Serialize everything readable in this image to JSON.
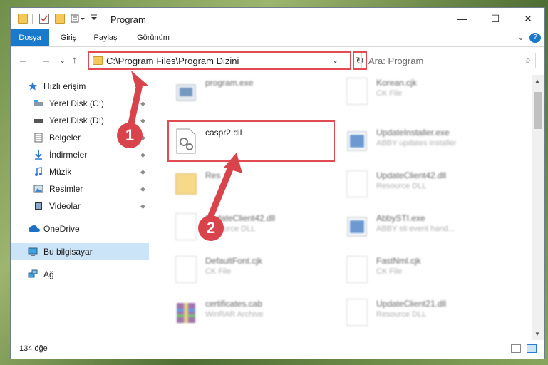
{
  "window": {
    "title": "Program",
    "minimize": "—",
    "maximize": "☐",
    "close": "✕"
  },
  "ribbon": {
    "tabs": [
      "Dosya",
      "Giriş",
      "Paylaş",
      "Görünüm"
    ],
    "expand": "⌄",
    "help": "?"
  },
  "nav": {
    "back": "←",
    "forward": "→",
    "recent": "⌄",
    "up": "↑",
    "address": "C:\\Program Files\\Program Dizini",
    "dropdown": "⌄",
    "refresh": "↻",
    "search_placeholder": "Ara: Program",
    "search_glyph": "⌕"
  },
  "sidebar": {
    "items": [
      {
        "label": "Hızlı erişim",
        "icon": "star-icon"
      },
      {
        "label": "Yerel Disk (C:)",
        "icon": "drive-icon",
        "pinned": true
      },
      {
        "label": "Yerel Disk (D:)",
        "icon": "drive-icon",
        "pinned": true
      },
      {
        "label": "Belgeler",
        "icon": "documents-icon",
        "pinned": true
      },
      {
        "label": "İndirmeler",
        "icon": "download-icon",
        "pinned": true
      },
      {
        "label": "Müzik",
        "icon": "music-icon",
        "pinned": true
      },
      {
        "label": "Resimler",
        "icon": "pictures-icon",
        "pinned": true
      },
      {
        "label": "Videolar",
        "icon": "video-icon",
        "pinned": true
      },
      {
        "label": "OneDrive",
        "icon": "cloud-icon"
      },
      {
        "label": "Bu bilgisayar",
        "icon": "computer-icon",
        "selected": true
      },
      {
        "label": "Ağ",
        "icon": "network-icon"
      }
    ],
    "pin_glyph": "📌"
  },
  "files": [
    {
      "name": "program.exe",
      "desc": "",
      "icon": "exe-icon"
    },
    {
      "name": "Korean.cjk",
      "desc": "CK File",
      "icon": "document-icon"
    },
    {
      "name": "caspr2.dll",
      "desc": "",
      "icon": "dll-icon"
    },
    {
      "name": "UpdateInstaller.exe",
      "desc": "ABBY updates installer",
      "icon": "exe-icon"
    },
    {
      "name": "Res",
      "desc": "",
      "icon": "folder-icon"
    },
    {
      "name": "UpdateClient42.dll",
      "desc": "Resource DLL",
      "icon": "dll-icon"
    },
    {
      "name": "UpdateClient42.dll",
      "desc": "Resource DLL",
      "icon": "dll-icon"
    },
    {
      "name": "AbbySTI.exe",
      "desc": "ABBY sti event hand...",
      "icon": "exe-icon"
    },
    {
      "name": "DefaultFont.cjk",
      "desc": "CK File",
      "icon": "document-icon"
    },
    {
      "name": "FastNml.cjk",
      "desc": "CK File",
      "icon": "document-icon"
    },
    {
      "name": "certificates.cab",
      "desc": "WinRAR Archive",
      "icon": "archive-icon"
    },
    {
      "name": "UpdateClient21.dll",
      "desc": "Resource DLL",
      "icon": "dll-icon"
    }
  ],
  "status": {
    "count": "134 öğe"
  },
  "annotations": {
    "step1": "1",
    "step2": "2",
    "color": "#d9434c"
  },
  "colors": {
    "accent": "#1979ca",
    "highlight_border": "#e24b52",
    "selected_bg": "#cce4f7"
  }
}
